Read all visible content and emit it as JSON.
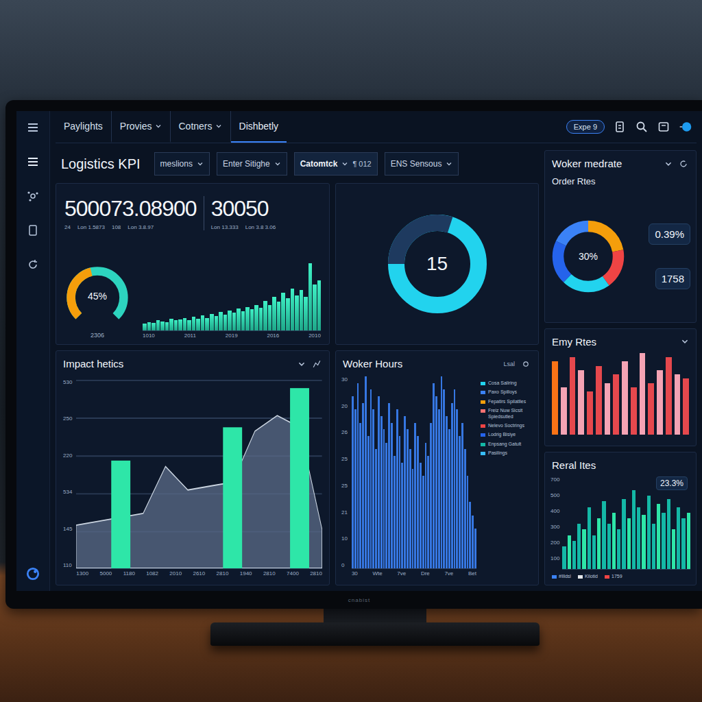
{
  "nav": {
    "tabs": [
      {
        "label": "Paylights",
        "dropdown": false,
        "selected": false
      },
      {
        "label": "Provies",
        "dropdown": true,
        "selected": false
      },
      {
        "label": "Cotners",
        "dropdown": true,
        "selected": false
      },
      {
        "label": "Dishbetly",
        "dropdown": false,
        "selected": true
      }
    ],
    "badge": "Expe 9"
  },
  "title": "Logistics KPI",
  "filters": [
    {
      "label": "meslions",
      "extra": "",
      "selected": false
    },
    {
      "label": "Enter Sitighe",
      "extra": "",
      "selected": false
    },
    {
      "label": "Catomtck",
      "extra": "¶ 012",
      "selected": true
    },
    {
      "label": "ENS Sensous",
      "extra": "",
      "selected": false
    }
  ],
  "kpi": {
    "values": [
      {
        "value": "500073.08900",
        "subs": [
          "24",
          "Lon 1.5873",
          "108",
          "Lon 3.8.97"
        ]
      },
      {
        "value": "30050",
        "subs": [
          "Lon 13.333",
          "Lon 3.8 3.06"
        ]
      }
    ],
    "gauge": {
      "reading": "45%",
      "caption": "2306",
      "level": 0.45
    },
    "chart": {
      "values": [
        8,
        10,
        9,
        12,
        11,
        10,
        14,
        12,
        13,
        15,
        12,
        16,
        14,
        18,
        15,
        20,
        17,
        22,
        19,
        24,
        21,
        26,
        23,
        28,
        25,
        30,
        27,
        35,
        30,
        40,
        34,
        45,
        38,
        50,
        42,
        48,
        40,
        80,
        55,
        60
      ],
      "x_ticks": [
        "1010",
        "2011",
        "2019",
        "2016",
        "2010"
      ]
    }
  },
  "donut": {
    "reading": "15",
    "level": 0.7
  },
  "impact": {
    "title": "Impact hetics",
    "y_ticks": [
      "530",
      "250",
      "220",
      "534",
      "145",
      "110"
    ],
    "x_ticks": [
      "1300",
      "5000",
      "1180",
      "1082",
      "2010",
      "2610",
      "2810",
      "1940",
      "2810",
      "7400",
      "2810"
    ],
    "area": [
      22,
      24,
      26,
      28,
      52,
      40,
      42,
      44,
      70,
      78,
      72,
      20
    ],
    "bars": [
      0,
      0,
      55,
      0,
      0,
      0,
      0,
      72,
      0,
      0,
      92,
      0
    ]
  },
  "hours": {
    "title": "Woker Hours",
    "badge": "Lsal",
    "y_ticks": [
      "30",
      "20",
      "26",
      "25",
      "25",
      "21",
      "10",
      "0"
    ],
    "x_ticks": [
      "30",
      "Wte",
      "7ve",
      "Dre",
      "7ve",
      "Bet"
    ],
    "values": [
      26,
      24,
      28,
      22,
      25,
      29,
      20,
      27,
      24,
      18,
      26,
      23,
      21,
      19,
      25,
      22,
      17,
      24,
      20,
      16,
      23,
      21,
      18,
      15,
      22,
      20,
      16,
      14,
      19,
      17,
      22,
      28,
      26,
      24,
      29,
      27,
      23,
      21,
      25,
      27,
      24,
      20,
      22,
      18,
      14,
      10,
      8,
      6
    ],
    "legend": [
      {
        "label": "Cosa Saliring",
        "color": "#22d3ee"
      },
      {
        "label": "Paxo Spilloys",
        "color": "#3b82f6"
      },
      {
        "label": "Fepatirs Spilatlles",
        "color": "#f59e0b"
      },
      {
        "label": "Freiz Nuw Sicsit Spiedsutled",
        "color": "#f87171"
      },
      {
        "label": "Nelevo Soctrings",
        "color": "#ef4444"
      },
      {
        "label": "Lodrig Bisiye",
        "color": "#2563eb"
      },
      {
        "label": "Enpsang Gatult",
        "color": "#14b8a6"
      },
      {
        "label": "Pasilings",
        "color": "#38bdf8"
      }
    ]
  },
  "orders": {
    "header": "Woker medrate",
    "title": "Order Rtes",
    "reading": "30%",
    "badge_top": "0.39%",
    "badge_bottom": "1758",
    "segments": [
      {
        "value": 22,
        "color": "#f59e0b"
      },
      {
        "value": 18,
        "color": "#ef4444"
      },
      {
        "value": 22,
        "color": "#22d3ee"
      },
      {
        "value": 20,
        "color": "#2563eb"
      },
      {
        "value": 18,
        "color": "#3b82f6"
      }
    ]
  },
  "errors": {
    "title": "Emy Rtes",
    "bars": [
      {
        "value": 85,
        "color": "#f97316"
      },
      {
        "value": 55,
        "color": "#f4a3b4"
      },
      {
        "value": 90,
        "color": "#e5484d"
      },
      {
        "value": 75,
        "color": "#f4a3b4"
      },
      {
        "value": 50,
        "color": "#e5484d"
      },
      {
        "value": 80,
        "color": "#e5484d"
      },
      {
        "value": 60,
        "color": "#f4a3b4"
      },
      {
        "value": 70,
        "color": "#e5484d"
      },
      {
        "value": 85,
        "color": "#f4a3b4"
      },
      {
        "value": 55,
        "color": "#e5484d"
      },
      {
        "value": 95,
        "color": "#f4a3b4"
      },
      {
        "value": 60,
        "color": "#e5484d"
      },
      {
        "value": 75,
        "color": "#f4a3b4"
      },
      {
        "value": 90,
        "color": "#e5484d"
      },
      {
        "value": 70,
        "color": "#f4a3b4"
      },
      {
        "value": 65,
        "color": "#e5484d"
      }
    ]
  },
  "rates": {
    "title": "Reral Ites",
    "tooltip": "23.3%",
    "y_ticks": [
      "700",
      "500",
      "400",
      "300",
      "200",
      "100"
    ],
    "values": [
      20,
      30,
      25,
      40,
      35,
      55,
      30,
      45,
      60,
      40,
      50,
      35,
      62,
      45,
      70,
      55,
      48,
      65,
      40,
      58,
      50,
      62,
      35,
      55,
      45,
      50
    ],
    "legend": [
      {
        "label": "#Illdsl",
        "color": "#3b82f6"
      },
      {
        "label": "Kilotid",
        "color": "#e5e7eb"
      },
      {
        "label": "1759",
        "color": "#ef4444"
      }
    ]
  },
  "brand": "cnabist"
}
